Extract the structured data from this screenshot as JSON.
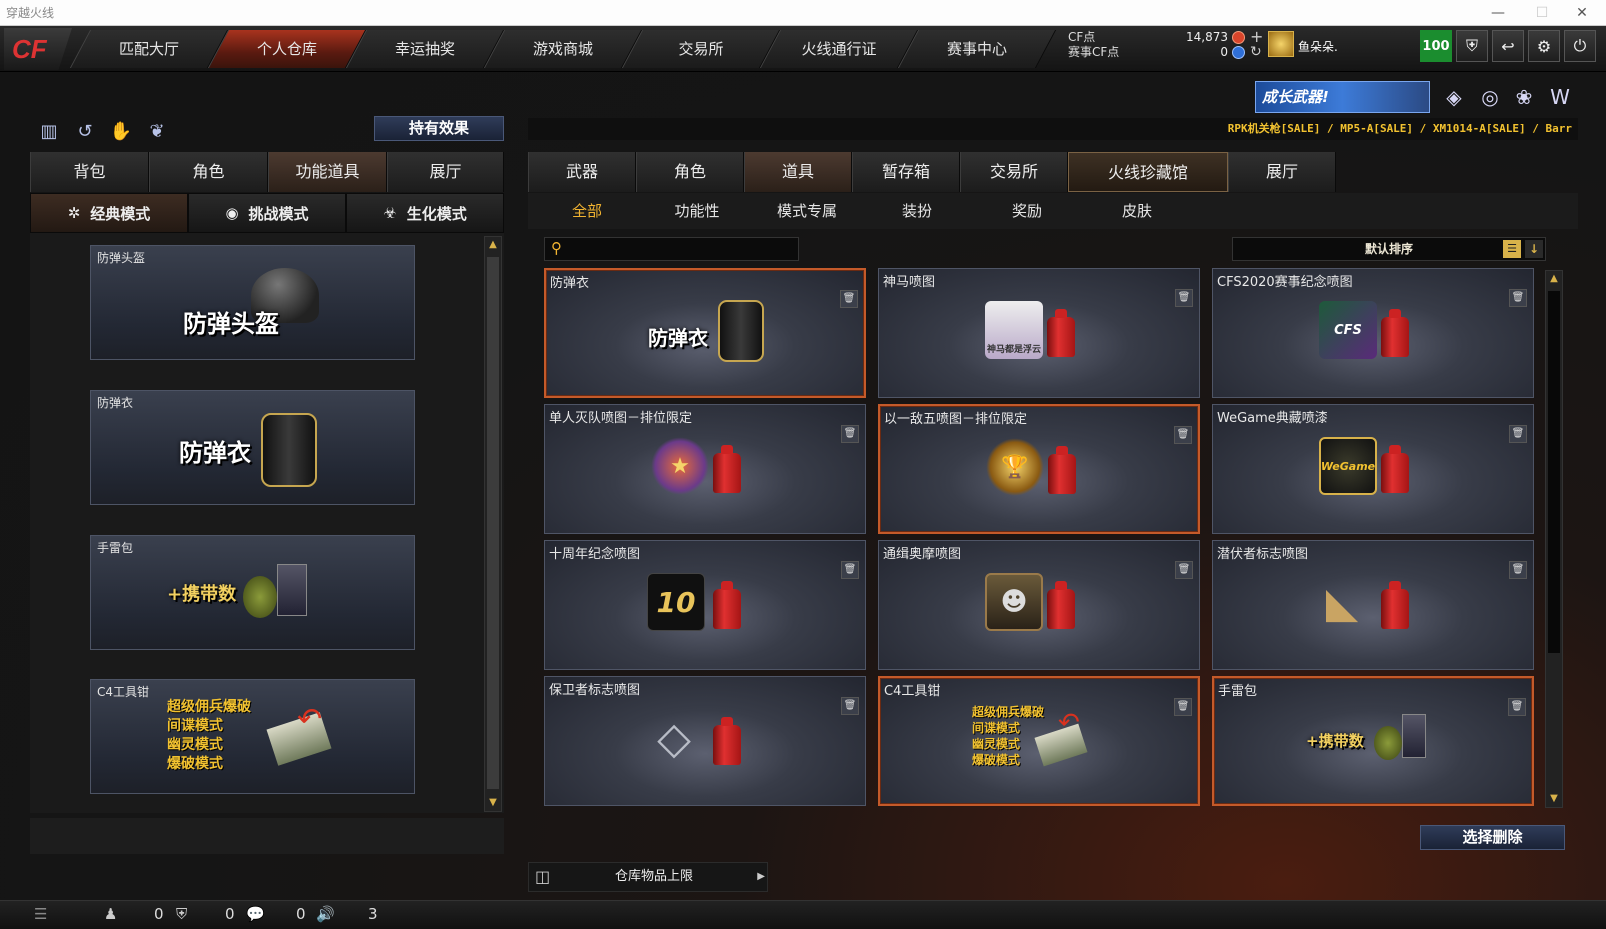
{
  "window": {
    "title": "穿越火线"
  },
  "logo": {
    "text": "CF"
  },
  "topnav": {
    "tabs": [
      "匹配大厅",
      "个人仓库",
      "幸运抽奖",
      "游戏商城",
      "交易所",
      "火线通行证",
      "赛事中心"
    ],
    "active": "个人仓库"
  },
  "currency": {
    "cf_label": "CF点",
    "cf_value": "14,873",
    "event_label": "赛事CF点",
    "event_value": "0"
  },
  "user": {
    "name": "鱼朵朵.",
    "level": "100"
  },
  "left": {
    "effect_button": "持有效果",
    "tabs": [
      "背包",
      "角色",
      "功能道具",
      "展厅"
    ],
    "active_tab": "功能道具",
    "modes": [
      "经典模式",
      "挑战模式",
      "生化模式"
    ],
    "active_mode": "经典模式",
    "items": [
      {
        "name": "防弹头盔",
        "art": "防弹头盔"
      },
      {
        "name": "防弹衣",
        "art": "防弹衣"
      },
      {
        "name": "手雷包",
        "art": "+携带数"
      },
      {
        "name": "C4工具钳",
        "art_lines": [
          "超级佣兵爆破",
          "间谍模式",
          "幽灵模式",
          "爆破模式"
        ]
      }
    ]
  },
  "right": {
    "promo": "成长武器!",
    "ticker": "RPK机关枪[SALE] / MP5-A[SALE] / XM1014-A[SALE] / Barr",
    "tabs": [
      "武器",
      "角色",
      "道具",
      "暂存箱",
      "交易所",
      "火线珍藏馆",
      "展厅"
    ],
    "active_tab": "道具",
    "highlight_tab": "火线珍藏馆",
    "subtabs": [
      "全部",
      "功能性",
      "模式专属",
      "装扮",
      "奖励",
      "皮肤"
    ],
    "active_subtab": "全部",
    "search_placeholder": "",
    "sort_label": "默认排序",
    "items": [
      {
        "name": "防弹衣",
        "kind": "vest",
        "art": "防弹衣",
        "selected": true
      },
      {
        "name": "神马喷图",
        "kind": "spray",
        "art": "神马都是浮云",
        "selected": false
      },
      {
        "name": "CFS2020赛事纪念喷图",
        "kind": "spray",
        "art": "CFS",
        "selected": false
      },
      {
        "name": "单人灭队喷图－排位限定",
        "kind": "spray",
        "art": "★",
        "selected": false
      },
      {
        "name": "以一敌五喷图－排位限定",
        "kind": "spray",
        "art": "🏆",
        "selected": true
      },
      {
        "name": "WeGame典藏喷漆",
        "kind": "spray",
        "art": "WeGame",
        "selected": false
      },
      {
        "name": "十周年纪念喷图",
        "kind": "spray",
        "art": "10",
        "selected": false
      },
      {
        "name": "通缉奥摩喷图",
        "kind": "spray",
        "art": "☻",
        "selected": false
      },
      {
        "name": "潜伏者标志喷图",
        "kind": "spray",
        "art": "◣",
        "selected": false
      },
      {
        "name": "保卫者标志喷图",
        "kind": "spray",
        "art": "◇",
        "selected": false
      },
      {
        "name": "C4工具钳",
        "kind": "c4",
        "art_lines": [
          "超级佣兵爆破",
          "间谍模式",
          "幽灵模式",
          "爆破模式"
        ],
        "selected": true
      },
      {
        "name": "手雷包",
        "kind": "grenade",
        "art": "+携带数",
        "selected": true
      }
    ],
    "delete_button": "选择删除",
    "capacity_label": "仓库物品上限"
  },
  "statusbar": {
    "friends": "0",
    "shield": "0",
    "chat": "0",
    "volume": "3"
  }
}
